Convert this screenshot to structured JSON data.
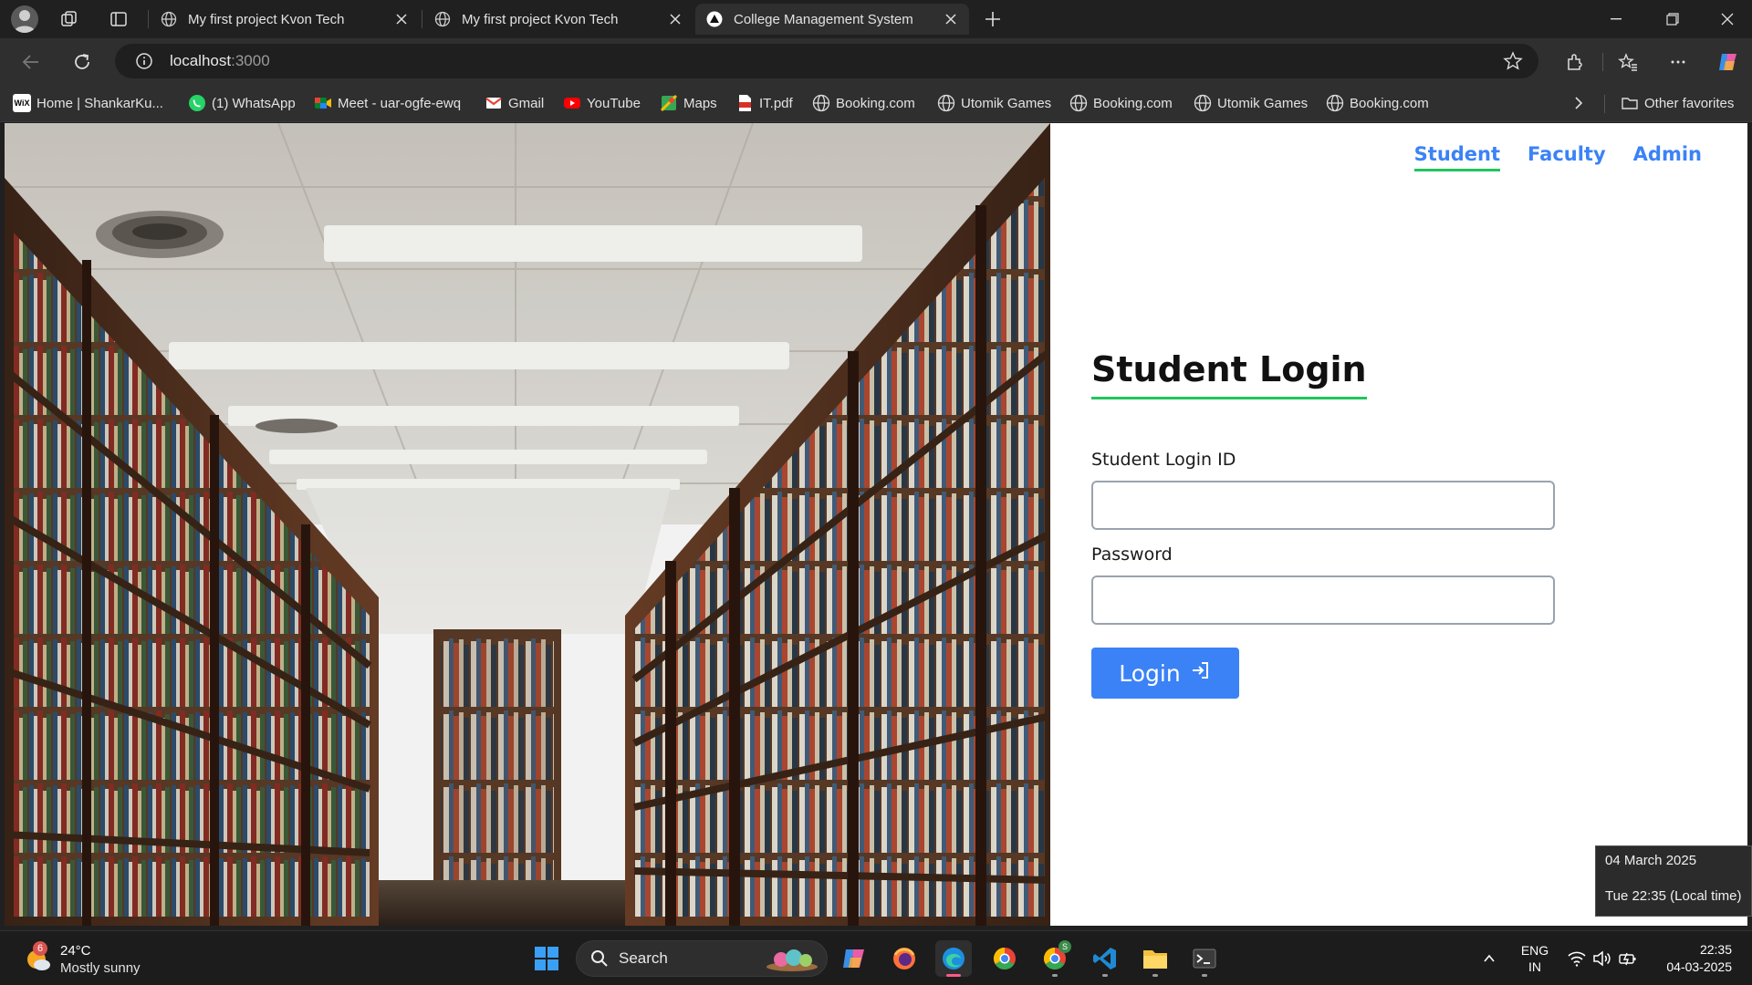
{
  "browser": {
    "tabs": [
      {
        "title": "My first project Kvon Tech",
        "active": false
      },
      {
        "title": "My first project Kvon Tech",
        "active": false
      },
      {
        "title": "College Management System",
        "active": true
      }
    ],
    "address": {
      "host": "localhost",
      "port": ":3000"
    },
    "bookmarks": [
      {
        "label": "Home | ShankarKu...",
        "icon": "wix-icon"
      },
      {
        "label": "(1) WhatsApp",
        "icon": "whatsapp-icon"
      },
      {
        "label": "Meet - uar-ogfe-ewq",
        "icon": "meet-icon"
      },
      {
        "label": "Gmail",
        "icon": "gmail-icon"
      },
      {
        "label": "YouTube",
        "icon": "youtube-icon"
      },
      {
        "label": "Maps",
        "icon": "maps-icon"
      },
      {
        "label": "IT.pdf",
        "icon": "pdf-icon"
      },
      {
        "label": "Booking.com",
        "icon": "globe-icon"
      },
      {
        "label": "Utomik Games",
        "icon": "globe-icon"
      },
      {
        "label": "Booking.com",
        "icon": "globe-icon"
      },
      {
        "label": "Utomik Games",
        "icon": "globe-icon"
      },
      {
        "label": "Booking.com",
        "icon": "globe-icon"
      }
    ],
    "other_favorites": "Other favorites"
  },
  "page": {
    "nav": [
      {
        "label": "Student",
        "active": true
      },
      {
        "label": "Faculty",
        "active": false
      },
      {
        "label": "Admin",
        "active": false
      }
    ],
    "title": "Student Login",
    "login_id_label": "Student Login ID",
    "password_label": "Password",
    "login_button": "Login",
    "accent_color": "#3b82f6",
    "underline_color": "#22c55e"
  },
  "tooltip": {
    "date": "04 March 2025",
    "time": "Tue 22:35 (Local time)"
  },
  "taskbar": {
    "weather_temp": "24°C",
    "weather_desc": "Mostly sunny",
    "weather_badge": "6",
    "search": "Search",
    "chrome_badge": "S",
    "lang_top": "ENG",
    "lang_bottom": "IN",
    "clock_time": "22:35",
    "clock_date": "04-03-2025"
  }
}
